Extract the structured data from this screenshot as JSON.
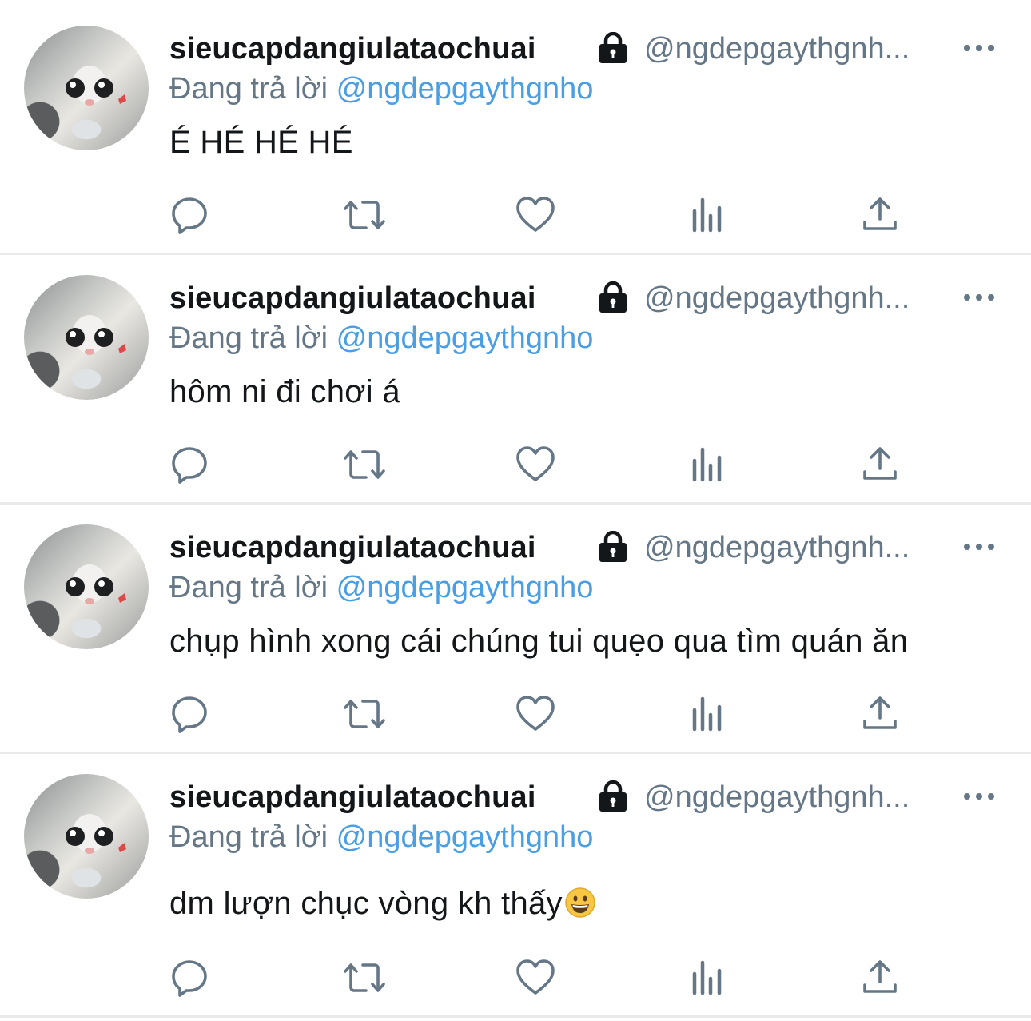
{
  "reply_prefix": "Đang trả lời",
  "tweets": [
    {
      "name": "sieucapdangiulataochuai",
      "handle": "@ngdepgaythgnh...",
      "replying_to": "@ngdepgaythgnho",
      "text": "É HÉ HÉ HÉ",
      "emoji": ""
    },
    {
      "name": "sieucapdangiulataochuai",
      "handle": "@ngdepgaythgnh...",
      "replying_to": "@ngdepgaythgnho",
      "text": "hôm ni đi chơi á",
      "emoji": ""
    },
    {
      "name": "sieucapdangiulataochuai",
      "handle": "@ngdepgaythgnh...",
      "replying_to": "@ngdepgaythgnho",
      "text": "chụp hình xong cái chúng tui quẹo qua tìm quán ăn",
      "emoji": ""
    },
    {
      "name": "sieucapdangiulataochuai",
      "handle": "@ngdepgaythgnh...",
      "replying_to": "@ngdepgaythgnho",
      "text": "dm lượn chục vòng kh thấy",
      "emoji": "grinning-face"
    }
  ],
  "actions": [
    "reply-icon",
    "retweet-icon",
    "like-icon",
    "analytics-icon",
    "share-icon"
  ],
  "colors": {
    "text": "#14171a",
    "secondary": "#657786",
    "mention": "#4a9ee3",
    "separator": "#e8eaec"
  }
}
